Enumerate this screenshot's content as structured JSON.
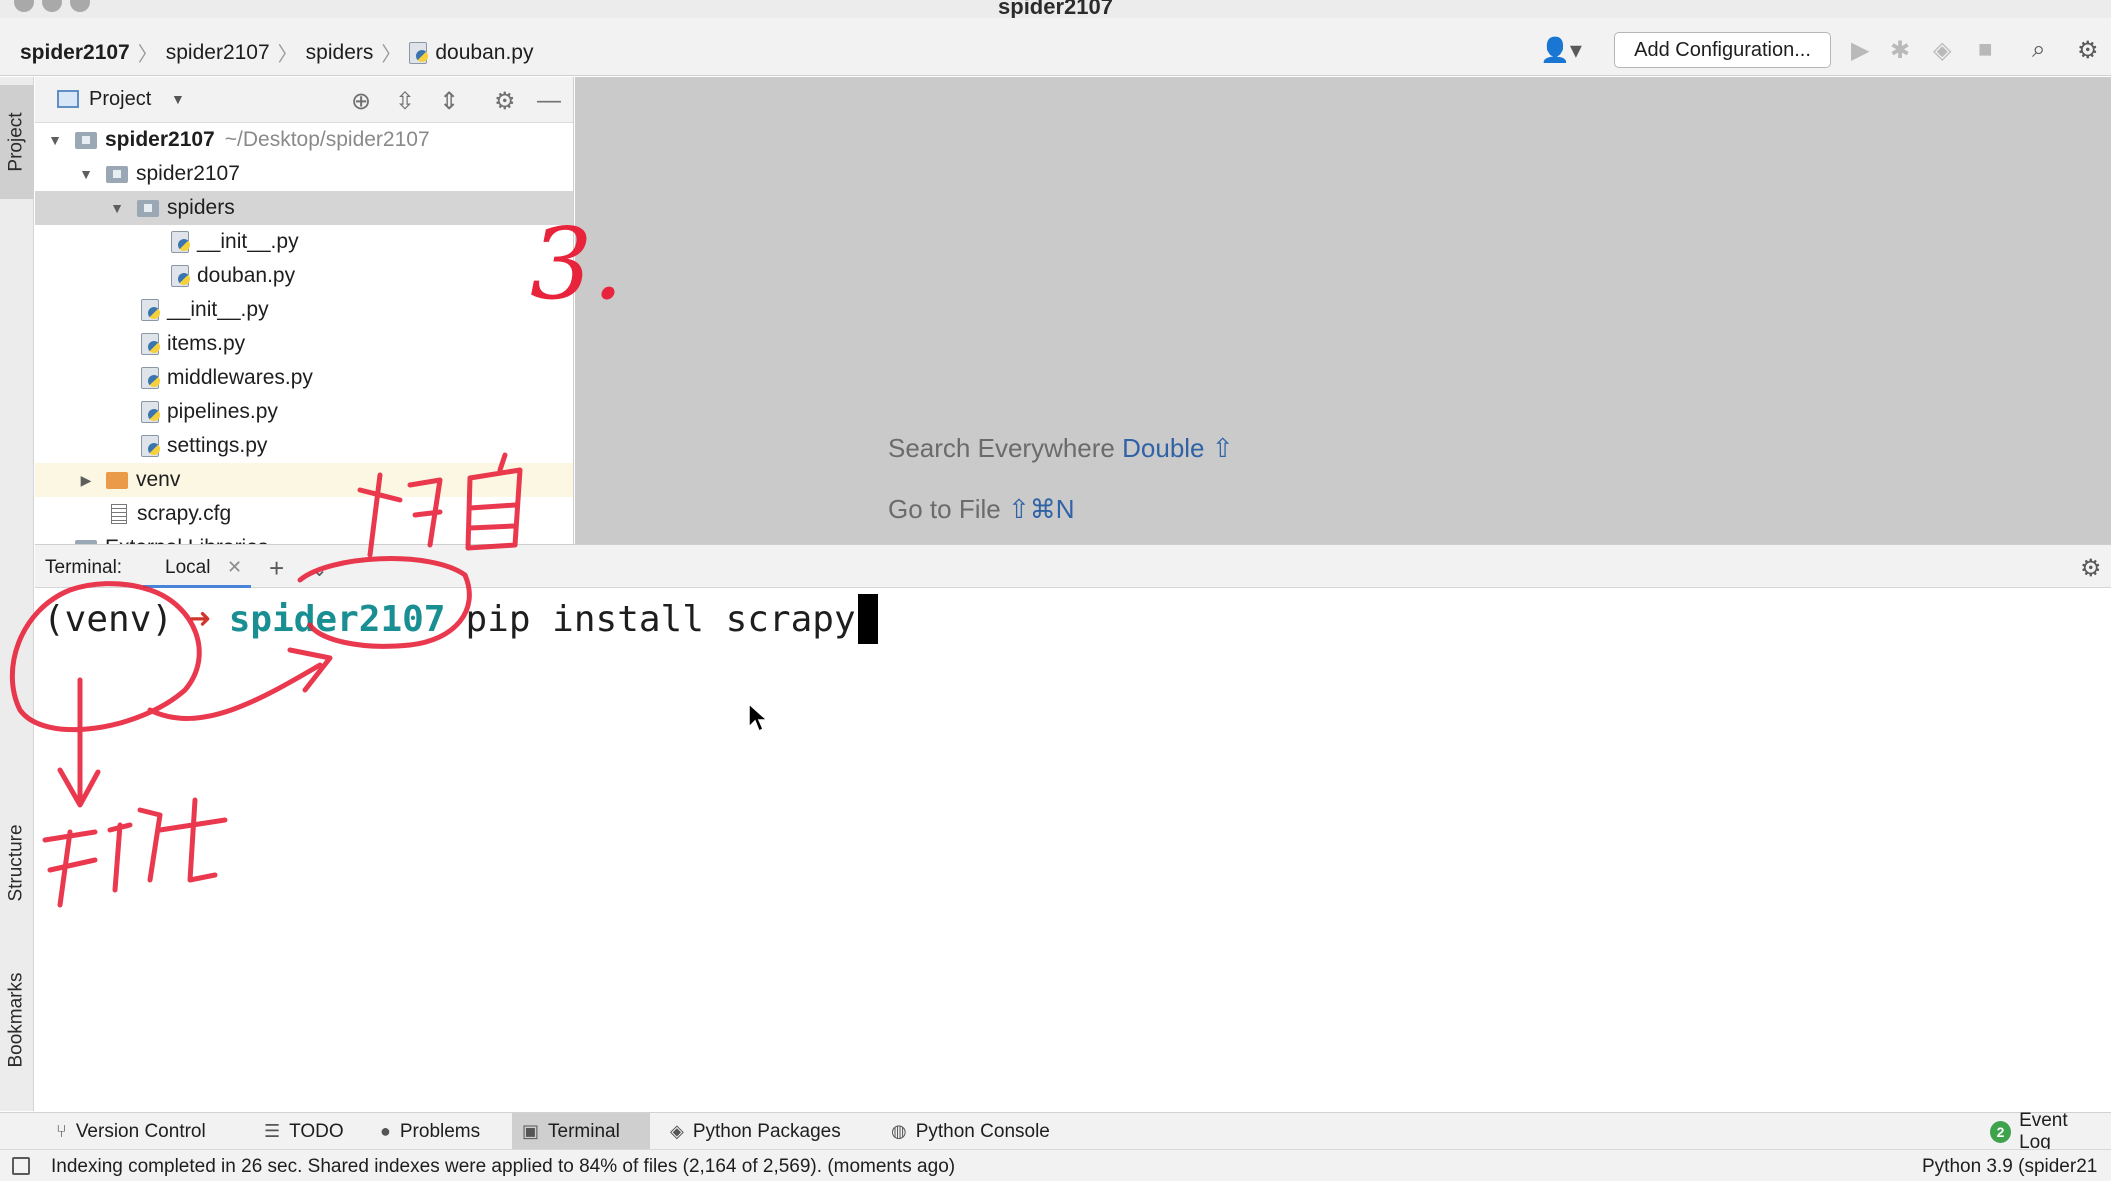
{
  "window": {
    "title": "spider2107"
  },
  "breadcrumbs": [
    "spider2107",
    "spider2107",
    "spiders",
    "douban.py"
  ],
  "toolbar": {
    "add_configuration": "Add Configuration..."
  },
  "left_strip": {
    "project": "Project",
    "structure": "Structure",
    "bookmarks": "Bookmarks"
  },
  "project_panel": {
    "title": "Project",
    "tree": [
      {
        "label": "spider2107",
        "suffix": "~/Desktop/spider2107"
      },
      {
        "label": "spider2107"
      },
      {
        "label": "spiders"
      },
      {
        "label": "__init__.py"
      },
      {
        "label": "douban.py"
      },
      {
        "label": "__init__.py"
      },
      {
        "label": "items.py"
      },
      {
        "label": "middlewares.py"
      },
      {
        "label": "pipelines.py"
      },
      {
        "label": "settings.py"
      },
      {
        "label": "venv"
      },
      {
        "label": "scrapy.cfg"
      },
      {
        "label": "External Libraries"
      }
    ]
  },
  "editor_hints": {
    "search_label": "Search Everywhere",
    "search_key": "Double ⇧",
    "goto_label": "Go to File",
    "goto_key": "⇧⌘N"
  },
  "terminal": {
    "label": "Terminal:",
    "tab": "Local",
    "prompt_env": "(venv)",
    "prompt_arrow": "➜",
    "prompt_dir": "spider2107",
    "command": "pip install scrapy"
  },
  "bottom_tools": {
    "version_control": "Version Control",
    "todo": "TODO",
    "problems": "Problems",
    "terminal": "Terminal",
    "python_packages": "Python Packages",
    "python_console": "Python Console",
    "event_count": "2",
    "event_log": "Event Log"
  },
  "status": {
    "message": "Indexing completed in 26 sec. Shared indexes were applied to 84% of files (2,164 of 2,569). (moments ago)",
    "interpreter": "Python 3.9 (spider21"
  },
  "annotations": {
    "number": "3."
  },
  "colors": {
    "accent": "#4a84d9",
    "prompt_dir": "#1a8f93",
    "annotation": "#e8243c"
  }
}
